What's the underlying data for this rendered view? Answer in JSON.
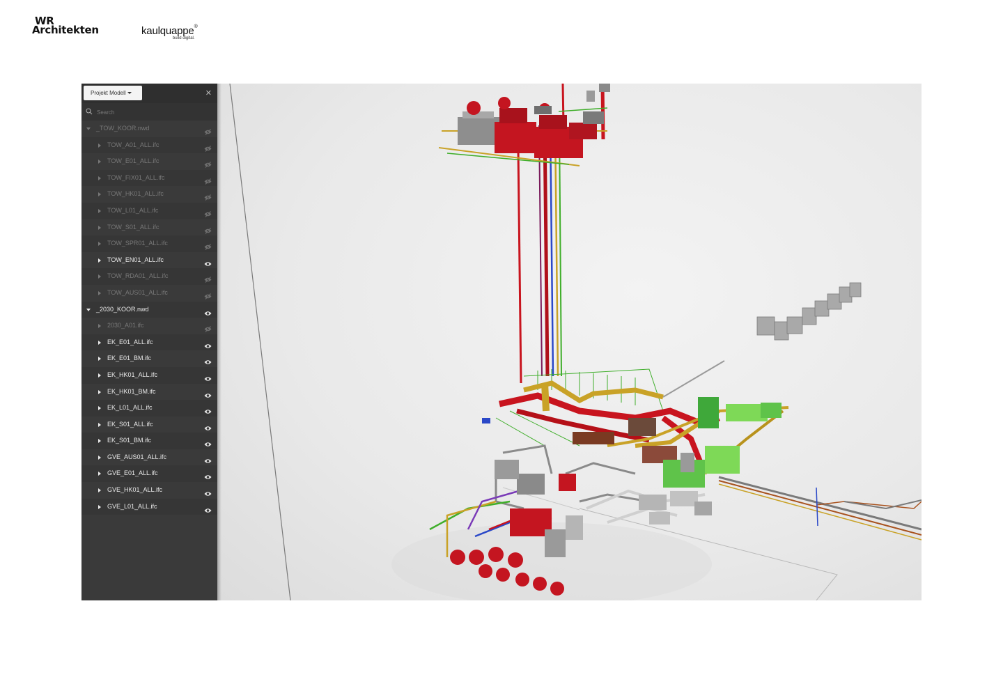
{
  "logos": {
    "wr_line1": "WR",
    "wr_line2": "Architekten",
    "kaulquappe_name": "kaulquappe",
    "kaulquappe_mark": "®",
    "kaulquappe_tagline": "build digital."
  },
  "panel": {
    "dropdown_label": "Projekt Modell",
    "close_icon": "close-icon",
    "search_placeholder": "Search",
    "items": [
      {
        "label": "_TOW_KOOR.nwd",
        "level": "parent",
        "visible": false
      },
      {
        "label": "TOW_A01_ALL.ifc",
        "level": "child",
        "visible": false
      },
      {
        "label": "TOW_E01_ALL.ifc",
        "level": "child",
        "visible": false
      },
      {
        "label": "TOW_FIX01_ALL.ifc",
        "level": "child",
        "visible": false
      },
      {
        "label": "TOW_HK01_ALL.ifc",
        "level": "child",
        "visible": false
      },
      {
        "label": "TOW_L01_ALL.ifc",
        "level": "child",
        "visible": false
      },
      {
        "label": "TOW_S01_ALL.ifc",
        "level": "child",
        "visible": false
      },
      {
        "label": "TOW_SPR01_ALL.ifc",
        "level": "child",
        "visible": false
      },
      {
        "label": "TOW_EN01_ALL.ifc",
        "level": "child",
        "visible": true
      },
      {
        "label": "TOW_RDA01_ALL.ifc",
        "level": "child",
        "visible": false
      },
      {
        "label": "TOW_AUS01_ALL.ifc",
        "level": "child",
        "visible": false
      },
      {
        "label": "_2030_KOOR.nwd",
        "level": "parent",
        "visible": true
      },
      {
        "label": "2030_A01.ifc",
        "level": "child",
        "visible": false
      },
      {
        "label": "EK_E01_ALL.ifc",
        "level": "child",
        "visible": true
      },
      {
        "label": "EK_E01_BM.ifc",
        "level": "child",
        "visible": true
      },
      {
        "label": "EK_HK01_ALL.ifc",
        "level": "child",
        "visible": true
      },
      {
        "label": "EK_HK01_BM.ifc",
        "level": "child",
        "visible": true
      },
      {
        "label": "EK_L01_ALL.ifc",
        "level": "child",
        "visible": true
      },
      {
        "label": "EK_S01_ALL.ifc",
        "level": "child",
        "visible": true
      },
      {
        "label": "EK_S01_BM.ifc",
        "level": "child",
        "visible": true
      },
      {
        "label": "GVE_AUS01_ALL.ifc",
        "level": "child",
        "visible": true
      },
      {
        "label": "GVE_E01_ALL.ifc",
        "level": "child",
        "visible": true
      },
      {
        "label": "GVE_HK01_ALL.ifc",
        "level": "child",
        "visible": true
      },
      {
        "label": "GVE_L01_ALL.ifc",
        "level": "child",
        "visible": true
      }
    ]
  },
  "colors": {
    "panel_bg": "#3a3a3a",
    "text_active": "#eaeaea",
    "text_hidden": "#787878",
    "pipe_red": "#c8141e",
    "pipe_yellow": "#c9a227",
    "pipe_green": "#3fae2a",
    "duct_lightgreen": "#7ed957",
    "equipment_grey": "#9a9a9a"
  },
  "icons": {
    "visible": "eye-icon",
    "hidden": "eye-slash-icon",
    "search": "search-icon"
  }
}
